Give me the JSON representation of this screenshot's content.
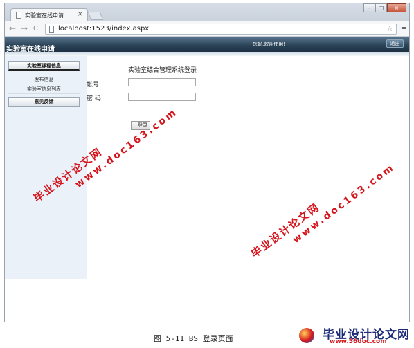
{
  "browser": {
    "tab_title": "实验室在线申请",
    "tab_close": "×",
    "url": "localhost:1523/index.aspx",
    "back_icon": "←",
    "forward_icon": "→",
    "reload_icon": "C",
    "star_icon": "☆",
    "menu_icon": "≡",
    "window_buttons": {
      "minimize": "–",
      "maximize": "□",
      "close": "×"
    }
  },
  "header": {
    "site_title": "实验室在线申请",
    "greeting": "您好,欢迎使用!",
    "logout_label": "退出"
  },
  "sidebar": {
    "group1_title": "实验室课程信息",
    "items": [
      "发布信息",
      "实验室信息列表"
    ],
    "group2_title": "意见反馈"
  },
  "login": {
    "title": "实验室综合管理系统登录",
    "username_label": "帐号:",
    "password_label": "密  码:",
    "username_value": "",
    "password_value": "",
    "button_label": "登录"
  },
  "watermark": {
    "name": "毕业设计论文网",
    "url": "www.doc163.com"
  },
  "caption": "图 5-11 BS 登录页面",
  "logo": {
    "name": "毕业设计论文网",
    "url": "www.56doc.com"
  },
  "colors": {
    "header_dark": "#1d3142",
    "sidebar_bg": "#eaf1f9",
    "watermark_red": "#d5141c"
  }
}
